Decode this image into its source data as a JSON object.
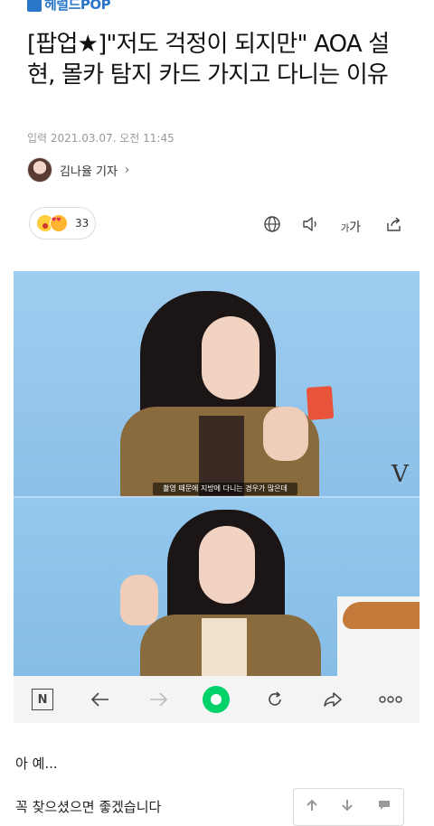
{
  "header": {
    "logo_text": "헤럴드POP"
  },
  "article": {
    "title": "[팝업★]\"저도 걱정이 되지만\" AOA 설현, 몰카 탐지 카드 가지고 다니는 이유",
    "dateline": "입력 2021.03.07. 오전 11:45",
    "author": "김나율 기자",
    "reactions": {
      "count": "33"
    }
  },
  "tools": {
    "globe_icon": "globe-icon",
    "speaker_icon": "speaker-icon",
    "font_label_small": "가",
    "font_label_large": "가",
    "share_icon": "share-icon"
  },
  "image": {
    "caption": "촬영 때문에 지방에 다니는 경우가 많은데",
    "watermark": "V"
  },
  "nav": {
    "n_label": "N"
  },
  "comments": [
    {
      "text": "아 예..."
    },
    {
      "text": "꼭 찾으셨으면 좋겠습니다"
    }
  ],
  "colors": {
    "brand": "#2a76c9",
    "accent_green": "#00d26a"
  }
}
